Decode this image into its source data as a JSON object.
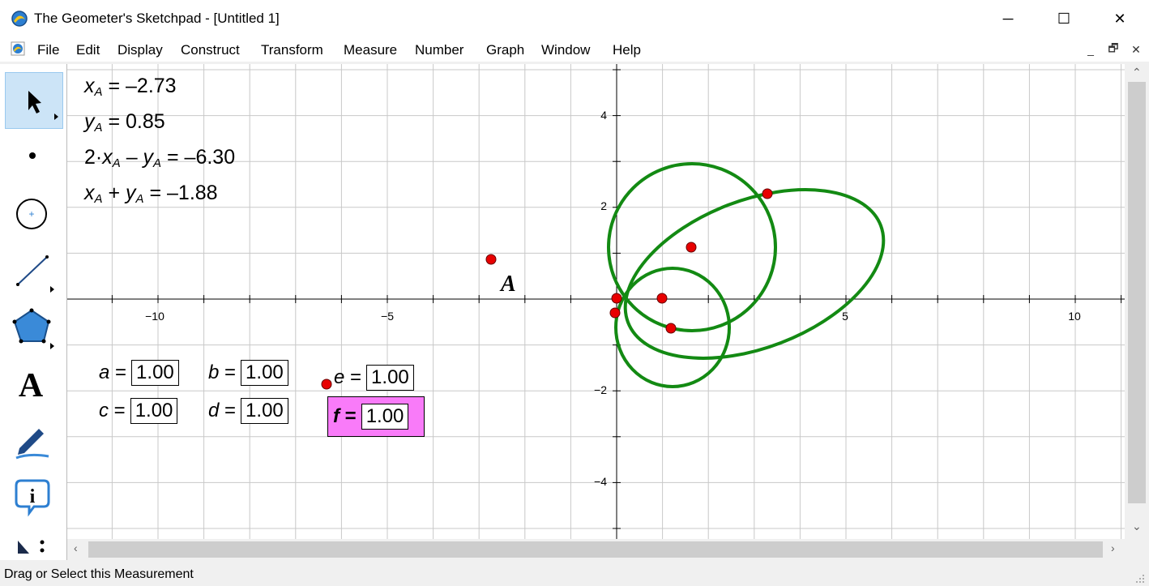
{
  "window": {
    "title": "The Geometer's Sketchpad - [Untitled 1]",
    "controls": {
      "minimize": "─",
      "maximize": "☐",
      "close": "✕"
    },
    "mdi_controls": {
      "minimize": "_",
      "restore": "🗗",
      "close": "✕"
    }
  },
  "menu": [
    "File",
    "Edit",
    "Display",
    "Construct",
    "Transform",
    "Measure",
    "Number",
    "Graph",
    "Window",
    "Help"
  ],
  "toolbox": [
    "arrow-select-tool",
    "point-tool",
    "compass-tool",
    "straightedge-tool",
    "polygon-tool",
    "text-tool",
    "marker-tool",
    "information-tool",
    "custom-tools"
  ],
  "measurements": {
    "xa": {
      "var": "x",
      "sub": "A",
      "eq": " = –2.73"
    },
    "ya": {
      "var": "y",
      "sub": "A",
      "eq": " = 0.85"
    },
    "expr1": {
      "pre": "2·",
      "var1": "x",
      "sub1": "A",
      "op": " – ",
      "var2": "y",
      "sub2": "A",
      "eq": " = –6.30"
    },
    "expr2": {
      "var1": "x",
      "sub1": "A",
      "op": " + ",
      "var2": "y",
      "sub2": "A",
      "eq": " = –1.88"
    }
  },
  "parameters": {
    "a": {
      "name": "a",
      "value": "1.00"
    },
    "b": {
      "name": "b",
      "value": "1.00"
    },
    "c": {
      "name": "c",
      "value": "1.00"
    },
    "d": {
      "name": "d",
      "value": "1.00"
    },
    "e": {
      "name": "e",
      "value": "1.00"
    },
    "f": {
      "name": "f",
      "value": "1.00"
    }
  },
  "graph": {
    "x_ticks": [
      "−10",
      "−5",
      "5",
      "10"
    ],
    "y_ticks": [
      "4",
      "2",
      "−2",
      "−4"
    ],
    "point_label": "A",
    "curve_color": "#138a13",
    "point_color": "#e80000",
    "param_highlight": "#f97bf9"
  },
  "status": "Drag or Select this Measurement"
}
